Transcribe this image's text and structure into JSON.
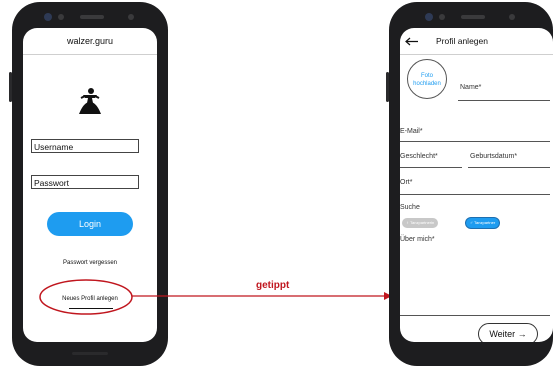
{
  "login_screen": {
    "app_title": "walzer.guru",
    "logo_icon": "dancer-logo-icon",
    "username_value": "Username",
    "password_value": "Passwort",
    "login_label": "Login",
    "forgot_label": "Passwort vergessen",
    "new_profile_label": "Neues Profil anlegen"
  },
  "annotation": {
    "arrow_label": "getippt",
    "color": "#c0161e"
  },
  "profile_screen": {
    "back_icon": "arrow-left-icon",
    "title": "Profil anlegen",
    "photo_label_line1": "Foto",
    "photo_label_line2": "hochladen",
    "name_label": "Name*",
    "email_label": "E-Mail*",
    "gender_label": "Geschlecht*",
    "birthdate_label": "Geburtsdatum*",
    "city_label": "Ort*",
    "search_label": "Suche",
    "toggle_off_label": "Tanzpartnerin",
    "toggle_on_label": "Tanzpartner",
    "about_label": "Über mich*",
    "next_label": "Weiter",
    "next_icon": "arrow-right-icon"
  },
  "colors": {
    "accent": "#1e9cf0",
    "phone_body": "#1d1d1f"
  }
}
